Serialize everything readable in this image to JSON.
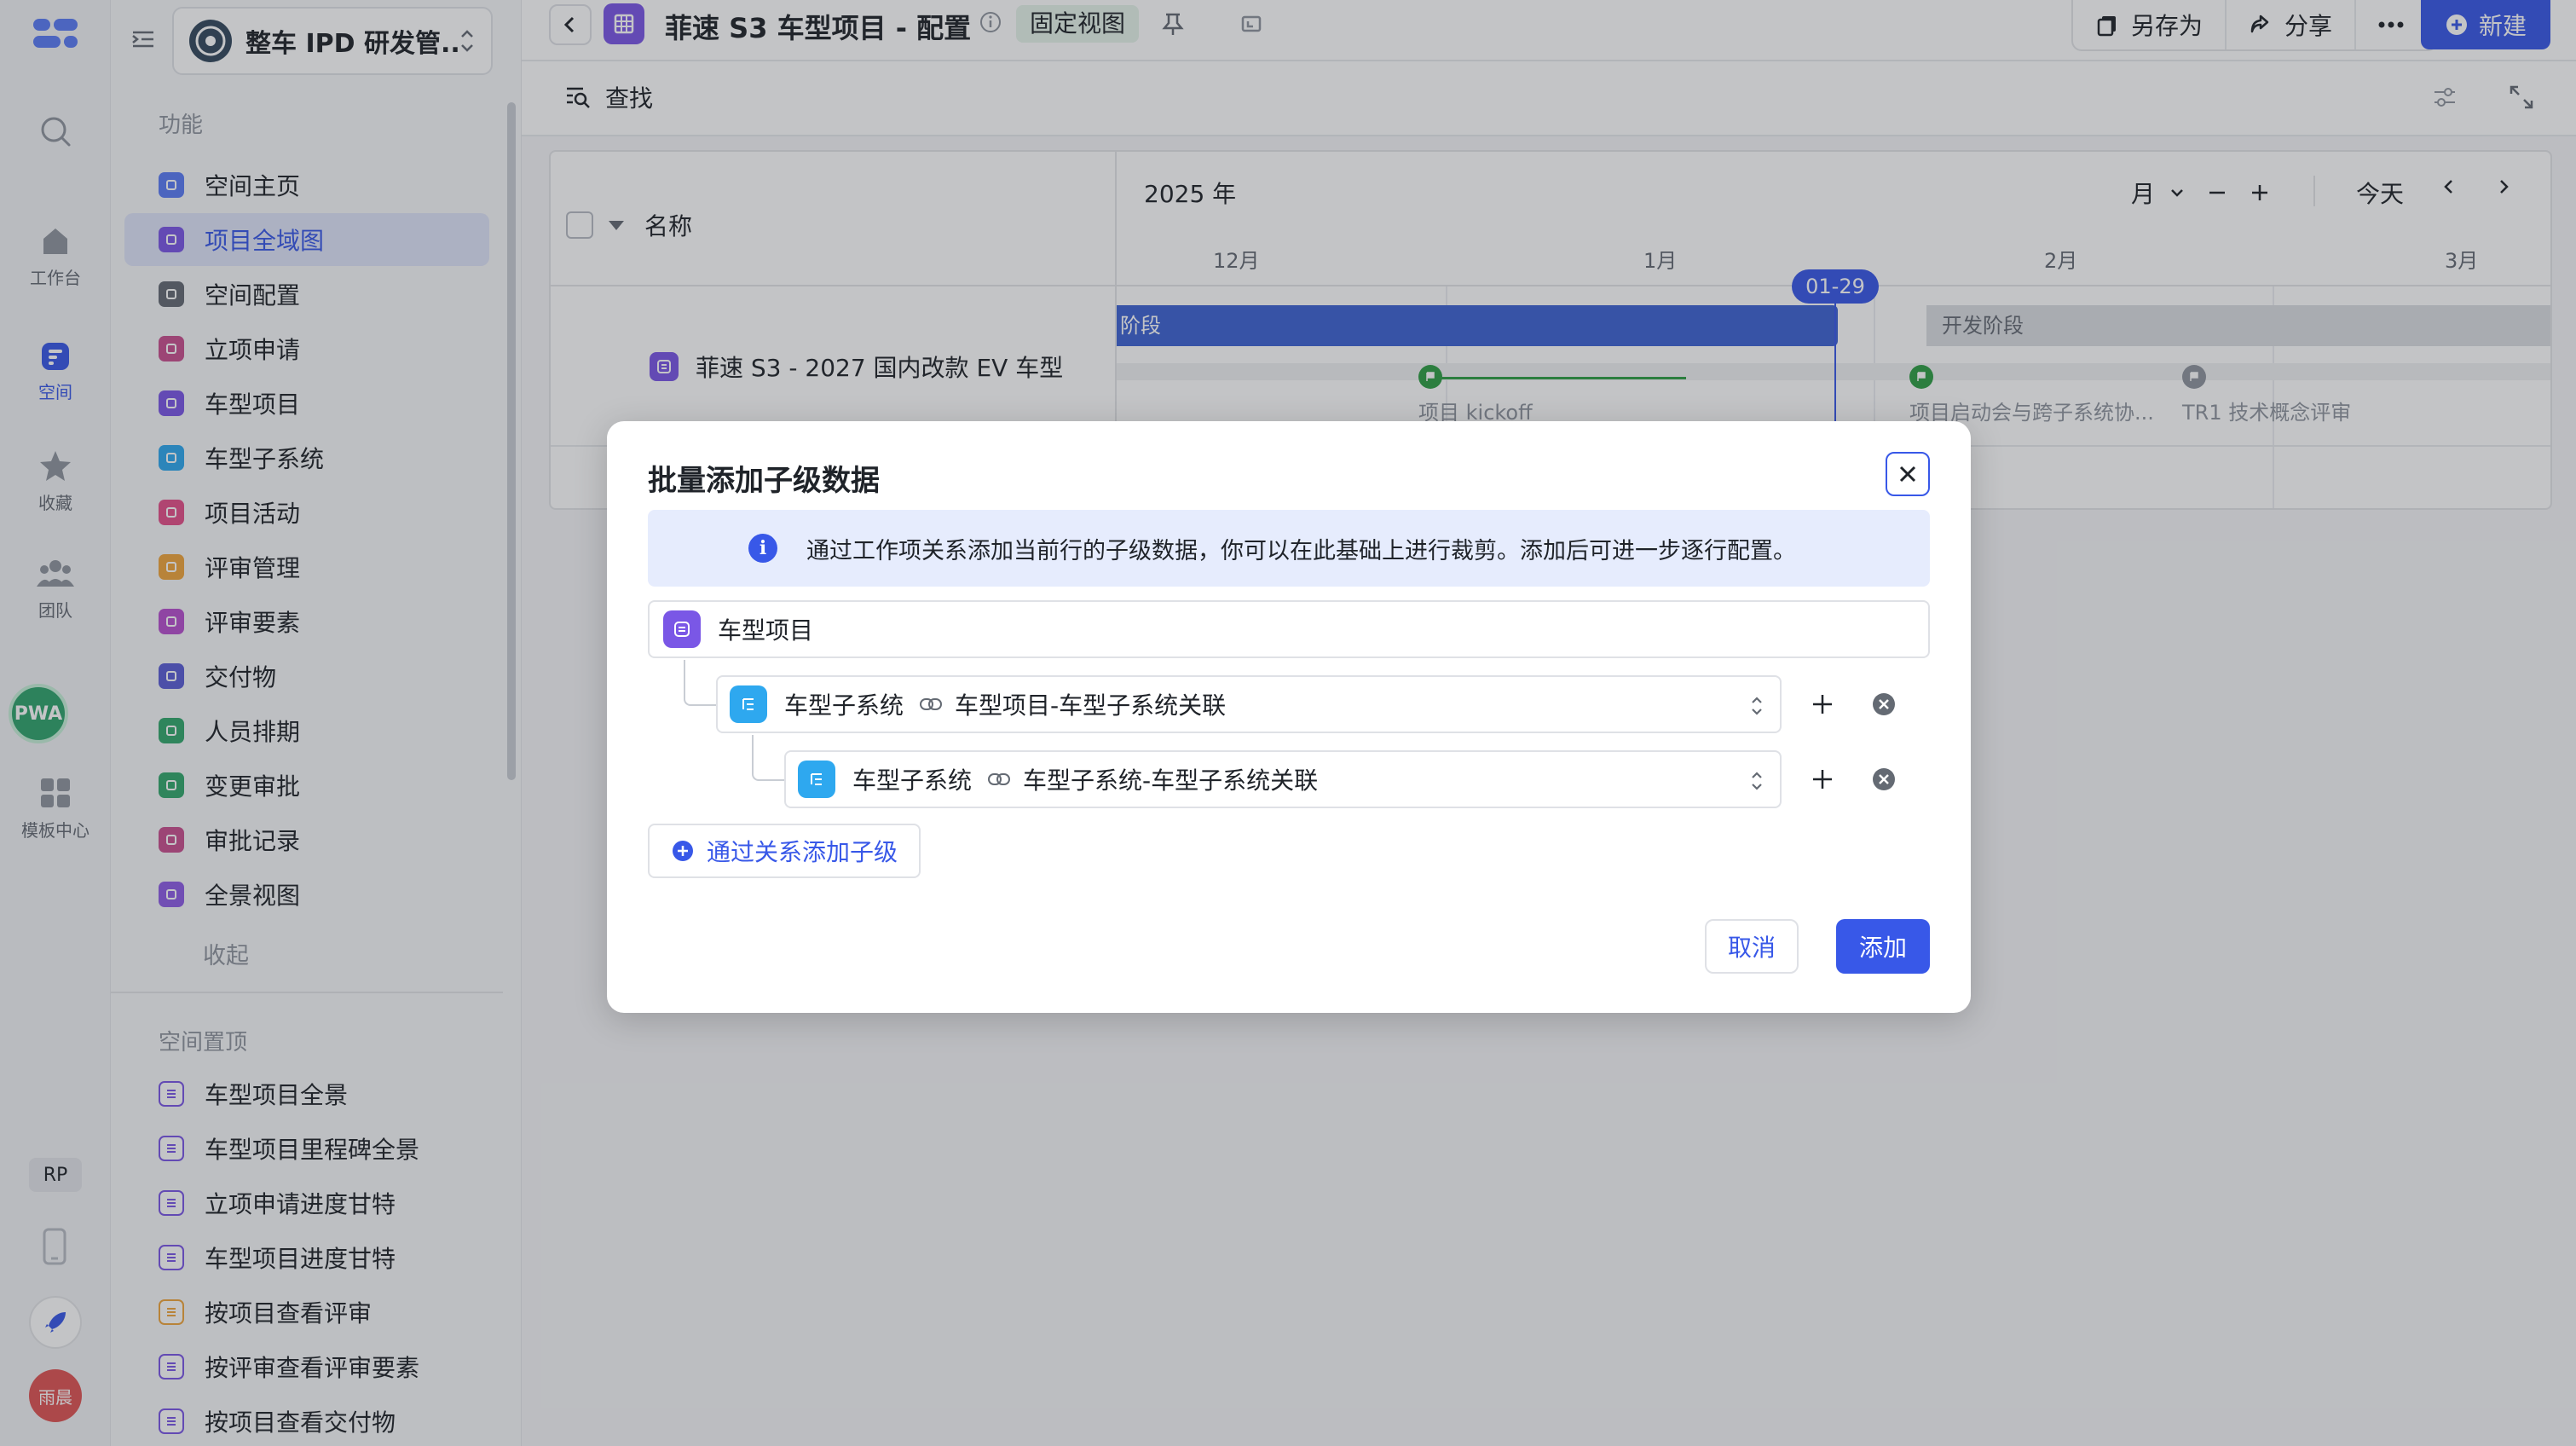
{
  "rail": {
    "items": [
      {
        "label": ""
      },
      {
        "label": "工作台"
      },
      {
        "label": "空间"
      },
      {
        "label": "收藏"
      },
      {
        "label": "团队"
      },
      {
        "label": "模板中心"
      }
    ],
    "pwa_label": "PWA",
    "rp_label": "RP",
    "user_avatar": "雨晨"
  },
  "sidebar": {
    "space_name": "整车 IPD 研发管...",
    "section_function": "功能",
    "items": [
      {
        "label": "空间主页",
        "color": "#5b7cf6"
      },
      {
        "label": "项目全域图",
        "color": "#7a57e6"
      },
      {
        "label": "空间配置",
        "color": "#646a73"
      },
      {
        "label": "立项申请",
        "color": "#c94f8f"
      },
      {
        "label": "车型项目",
        "color": "#7a57e6"
      },
      {
        "label": "车型子系统",
        "color": "#2ea8ef"
      },
      {
        "label": "项目活动",
        "color": "#e5508a"
      },
      {
        "label": "评审管理",
        "color": "#f0a53c"
      },
      {
        "label": "评审要素",
        "color": "#b84fcf"
      },
      {
        "label": "交付物",
        "color": "#5a5ed6"
      },
      {
        "label": "人员排期",
        "color": "#33a86d"
      },
      {
        "label": "变更审批",
        "color": "#33a86d"
      },
      {
        "label": "审批记录",
        "color": "#c94f8f"
      },
      {
        "label": "全景视图",
        "color": "#8e5ce6"
      }
    ],
    "collapse_label": "收起",
    "section_pinned": "空间置顶",
    "pinned": [
      {
        "label": "车型项目全景",
        "color": "#7a57e6"
      },
      {
        "label": "车型项目里程碑全景",
        "color": "#7a57e6"
      },
      {
        "label": "立项申请进度甘特",
        "color": "#7a57e6"
      },
      {
        "label": "车型项目进度甘特",
        "color": "#7a57e6"
      },
      {
        "label": "按项目查看评审",
        "color": "#f0a53c"
      },
      {
        "label": "按评审查看评审要素",
        "color": "#7a57e6"
      },
      {
        "label": "按项目查看交付物",
        "color": "#7a57e6"
      }
    ]
  },
  "header": {
    "title": "菲速 S3 车型项目 - 配置",
    "fixed_view_tag": "固定视图",
    "save_as": "另存为",
    "share": "分享",
    "new": "新建"
  },
  "subbar": {
    "find": "查找"
  },
  "gantt": {
    "name_col": "名称",
    "year": "2025 年",
    "months": [
      "12月",
      "1月",
      "2月",
      "3月"
    ],
    "scale": "月",
    "today": "今天",
    "today_marker": "01-29",
    "row_name": "菲速 S3 - 2027 国内改款 EV 车型",
    "phase_1": "阶段",
    "phase_2": "开发阶段",
    "milestones": [
      "项目 kickoff",
      "项目启动会与跨子系统协...",
      "TR1 技术概念评审"
    ]
  },
  "modal": {
    "title": "批量添加子级数据",
    "info": "通过工作项关系添加当前行的子级数据，你可以在此基础上进行裁剪。添加后可进一步逐行配置。",
    "root": "车型项目",
    "children": [
      {
        "type": "车型子系统",
        "relation": "车型项目-车型子系统关联"
      },
      {
        "type": "车型子系统",
        "relation": "车型子系统-车型子系统关联"
      }
    ],
    "add_by_relation": "通过关系添加子级",
    "cancel": "取消",
    "confirm": "添加"
  },
  "colors": {
    "primary": "#3858e8",
    "phase_active": "#3d63d3",
    "milestone_done": "#2f9e44"
  }
}
